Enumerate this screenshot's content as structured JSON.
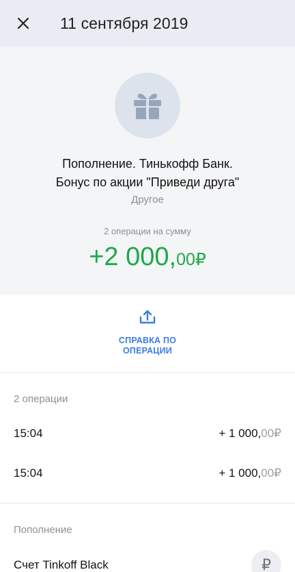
{
  "header": {
    "close_icon": "close-icon",
    "title": "11 сентября 2019"
  },
  "summary": {
    "icon": "gift-icon",
    "description_line1": "Пополнение. Тинькофф Банк.",
    "description_line2": "Бонус по акции \"Приведи друга\"",
    "category": "Другое",
    "ops_caption": "2 операции на сумму",
    "amount": {
      "main": "+2 000,",
      "cents": "00",
      "currency": "₽",
      "color": "#1fa74a"
    }
  },
  "receipt": {
    "icon": "share-upload-icon",
    "label": "СПРАВКА ПО ОПЕРАЦИИ",
    "color": "#3a7ee0"
  },
  "operations": {
    "title": "2 операции",
    "items": [
      {
        "time": "15:04",
        "amount_main": "+ 1 000,",
        "amount_cents": "00",
        "currency": "₽"
      },
      {
        "time": "15:04",
        "amount_main": "+ 1 000,",
        "amount_cents": "00",
        "currency": "₽"
      }
    ]
  },
  "topup": {
    "title": "Пополнение",
    "account_name": "Счет Tinkoff Black",
    "account_icon": "ruble-icon",
    "account_icon_glyph": "₽"
  }
}
